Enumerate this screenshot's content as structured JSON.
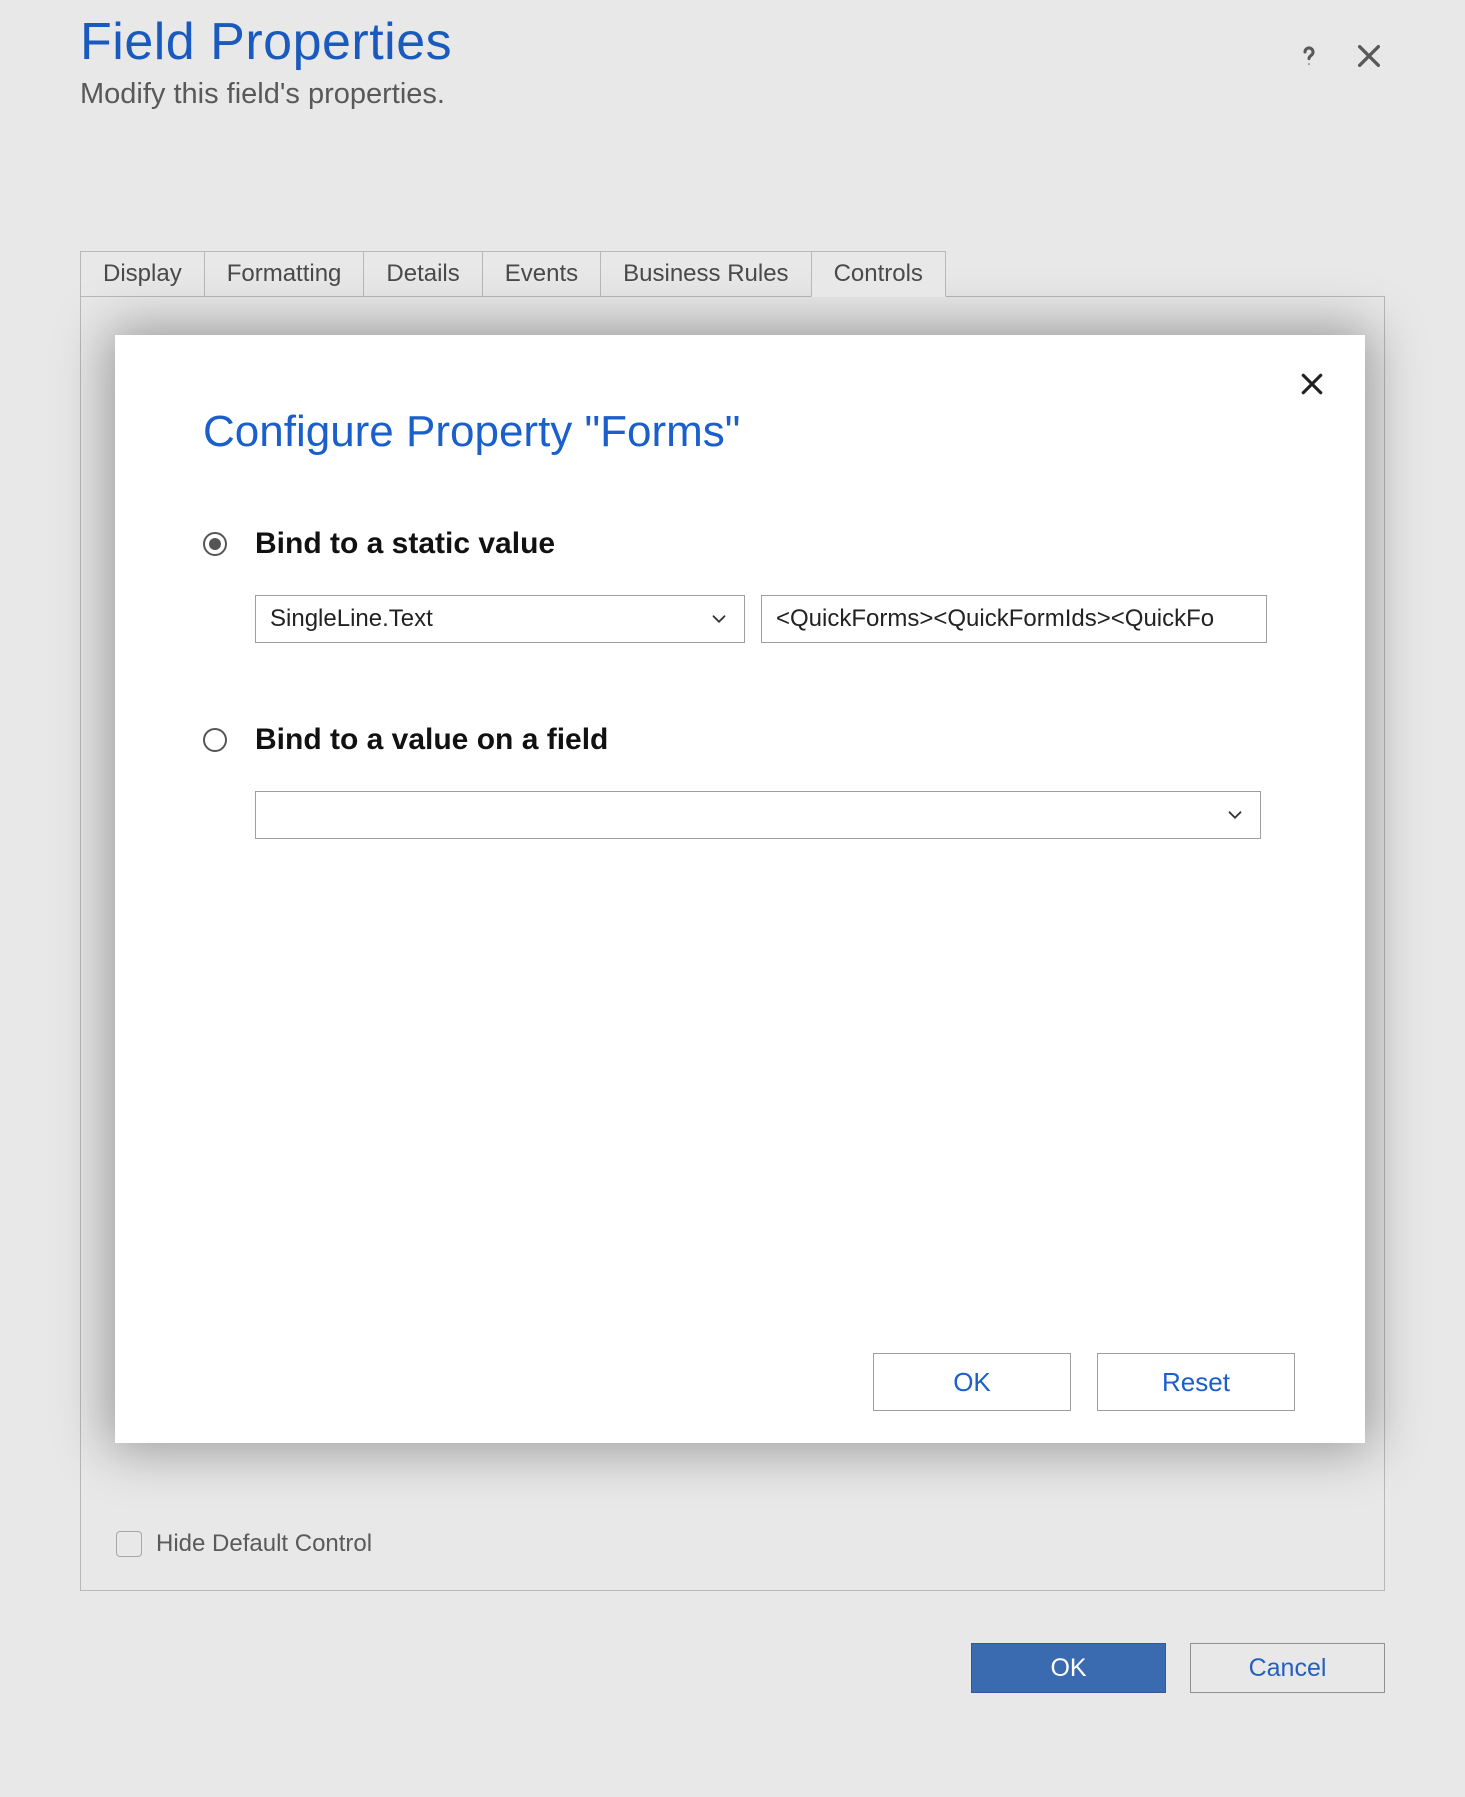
{
  "header": {
    "title": "Field Properties",
    "subtitle": "Modify this field's properties."
  },
  "tabs": [
    "Display",
    "Formatting",
    "Details",
    "Events",
    "Business Rules",
    "Controls"
  ],
  "panel": {
    "hide_default_label": "Hide Default Control"
  },
  "footer": {
    "ok": "OK",
    "cancel": "Cancel"
  },
  "modal": {
    "title": "Configure Property \"Forms\"",
    "option_static": {
      "label": "Bind to a static value",
      "type_value": "SingleLine.Text",
      "text_value": "<QuickForms><QuickFormIds><QuickFo"
    },
    "option_field": {
      "label": "Bind to a value on a field",
      "select_value": ""
    },
    "ok": "OK",
    "reset": "Reset"
  }
}
